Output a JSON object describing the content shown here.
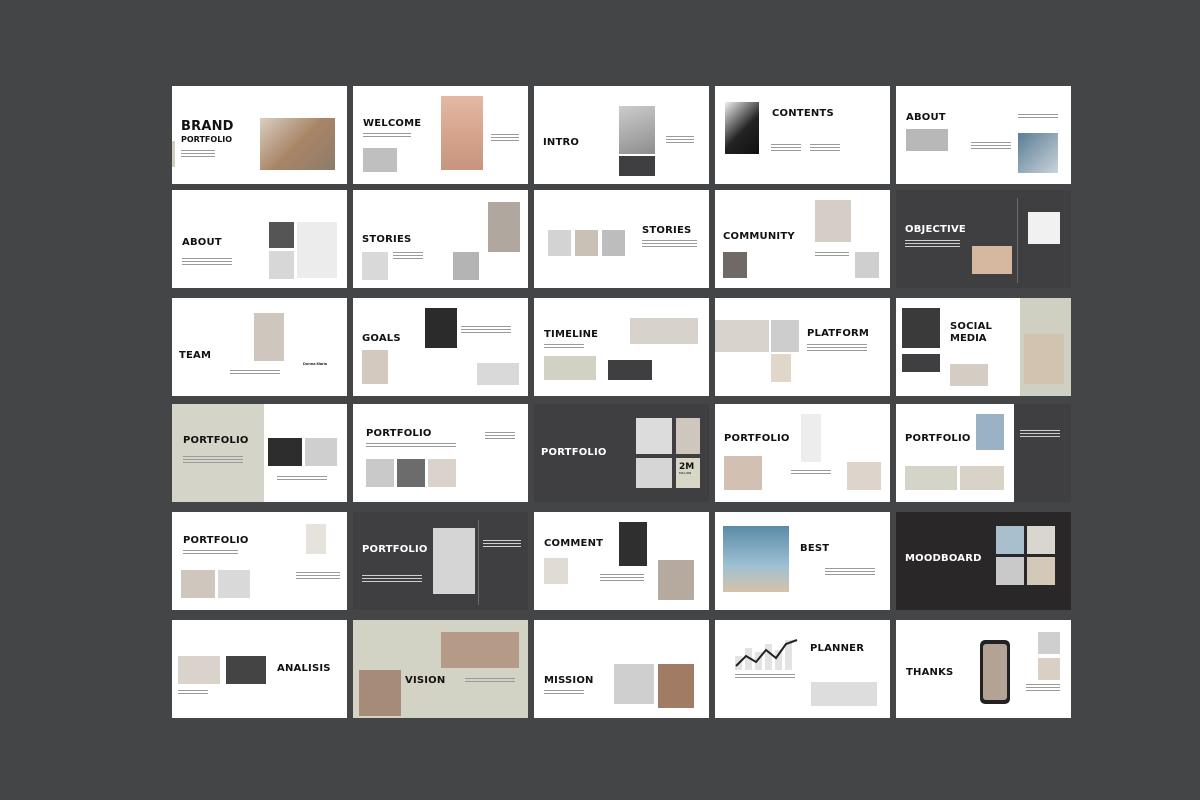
{
  "colors": {
    "background": "#444547",
    "slide_light": "#ffffff",
    "slide_dark": "#3f3f41",
    "slide_darker": "#2a2728",
    "accent_sage": "#d4d4c8"
  },
  "slides": [
    {
      "title": "BRAND",
      "subtitle": "PORTFOLIO"
    },
    {
      "title": "WELCOME"
    },
    {
      "title": "INTRO"
    },
    {
      "title": "CONTENTS"
    },
    {
      "title": "ABOUT"
    },
    {
      "title": "ABOUT"
    },
    {
      "title": "STORIES"
    },
    {
      "title": "STORIES"
    },
    {
      "title": "COMMUNITY"
    },
    {
      "title": "OBJECTIVE"
    },
    {
      "title": "TEAM",
      "name": "Donna Maria"
    },
    {
      "title": "GOALS"
    },
    {
      "title": "TIMELINE"
    },
    {
      "title": "PLATFORM"
    },
    {
      "title": "SOCIAL",
      "subtitle": "MEDIA"
    },
    {
      "title": "PORTFOLIO"
    },
    {
      "title": "PORTFOLIO"
    },
    {
      "title": "PORTFOLIO",
      "stat": "2M",
      "stat_sub": "MILLION"
    },
    {
      "title": "PORTFOLIO"
    },
    {
      "title": "PORTFOLIO"
    },
    {
      "title": "PORTFOLIO"
    },
    {
      "title": "PORTFOLIO"
    },
    {
      "title": "COMMENT"
    },
    {
      "title": "BEST"
    },
    {
      "title": "MOODBOARD"
    },
    {
      "title": "ANALISIS"
    },
    {
      "title": "VISION"
    },
    {
      "title": "MISSION"
    },
    {
      "title": "PLANNER"
    },
    {
      "title": "THANKS"
    }
  ]
}
